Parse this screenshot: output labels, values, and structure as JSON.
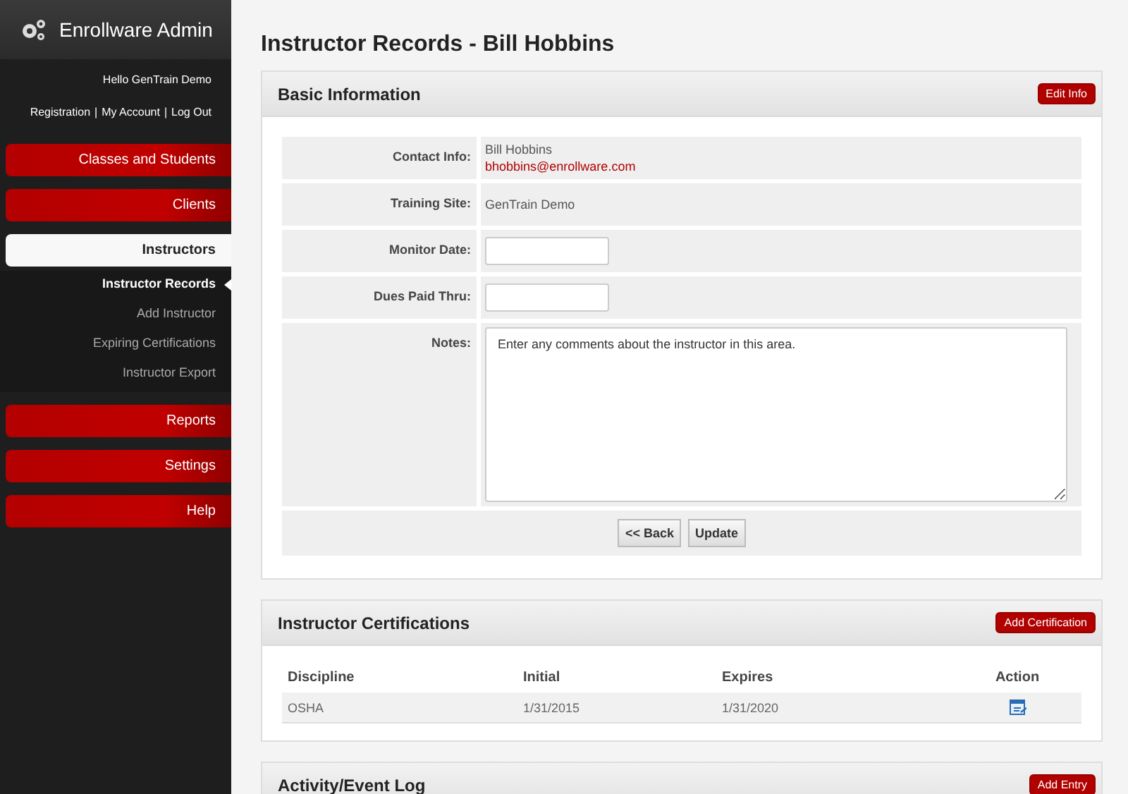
{
  "app": {
    "title": "Enrollware Admin",
    "greeting": "Hello GenTrain Demo",
    "links": [
      "Registration",
      "My Account",
      "Log Out"
    ],
    "link_separator": "|"
  },
  "nav": [
    {
      "label": "Classes and Students",
      "selected": false
    },
    {
      "label": "Clients",
      "selected": false
    },
    {
      "label": "Instructors",
      "selected": true,
      "children": [
        {
          "label": "Instructor Records",
          "selected": true
        },
        {
          "label": "Add Instructor",
          "selected": false
        },
        {
          "label": "Expiring Certifications",
          "selected": false
        },
        {
          "label": "Instructor Export",
          "selected": false
        }
      ]
    },
    {
      "label": "Reports",
      "selected": false
    },
    {
      "label": "Settings",
      "selected": false
    },
    {
      "label": "Help",
      "selected": false
    }
  ],
  "page_title": "Instructor Records - Bill Hobbins",
  "basic_info": {
    "title": "Basic Information",
    "button": "Edit Info",
    "fields": [
      {
        "kind": "contact",
        "label": "Contact Info:",
        "name": "Bill Hobbins",
        "email": "bhobbins@enrollware.com"
      },
      {
        "kind": "text",
        "label": "Training Site:",
        "value": "GenTrain Demo"
      },
      {
        "kind": "input",
        "label": "Monitor Date:"
      },
      {
        "kind": "input",
        "label": "Dues Paid Thru:"
      },
      {
        "kind": "textarea",
        "label": "Notes:",
        "value": "Enter any comments about the instructor in this area."
      }
    ],
    "actions": [
      "<< Back",
      "Update"
    ]
  },
  "certifications": {
    "title": "Instructor Certifications",
    "button": "Add Certification",
    "columns": [
      "Discipline",
      "Initial",
      "Expires",
      "Action"
    ],
    "rows": [
      {
        "discipline": "OSHA",
        "initial": "1/31/2015",
        "expires": "1/31/2020"
      }
    ]
  },
  "activity_log": {
    "title": "Activity/Event Log",
    "button": "Add Entry"
  }
}
